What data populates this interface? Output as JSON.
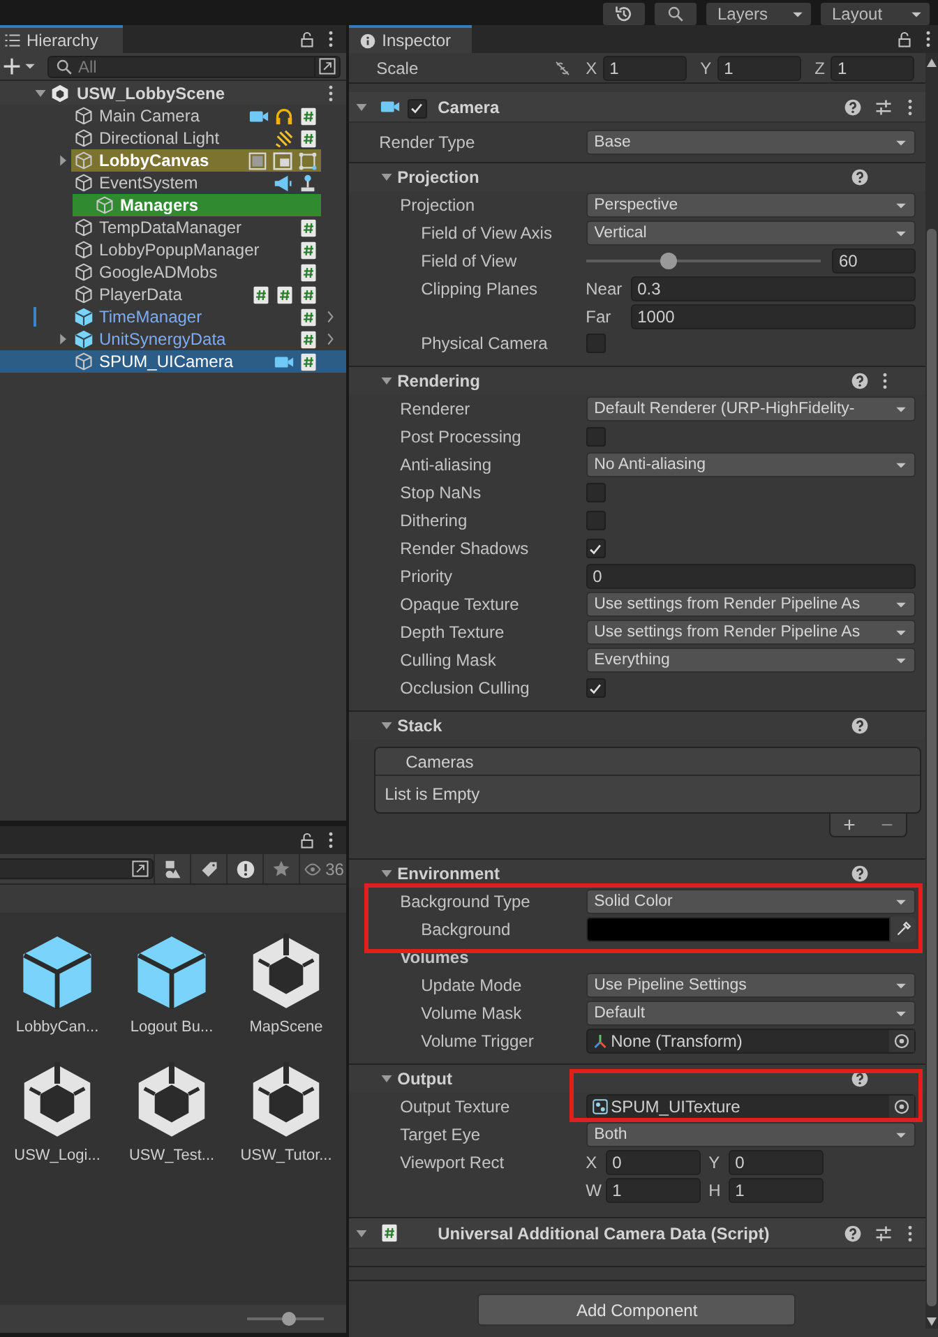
{
  "toolbar": {
    "buttons": [
      {
        "kind": "history"
      },
      {
        "kind": "search"
      }
    ],
    "dropdowns": [
      "Layers",
      "Layout"
    ]
  },
  "hierarchy": {
    "tab": "Hierarchy",
    "search": {
      "placeholder": "All"
    },
    "scene": {
      "name": "USW_LobbyScene",
      "expanded": true,
      "items": [
        {
          "name": "Main Camera",
          "kind": "object",
          "collapsed": false,
          "selected": false,
          "changed": false,
          "badges": [
            {
              "kind": "camera"
            },
            {
              "kind": "audio"
            },
            {
              "kind": "script"
            }
          ]
        },
        {
          "name": "Directional Light",
          "kind": "object",
          "collapsed": false,
          "selected": false,
          "changed": false,
          "badges": [
            {
              "kind": "light"
            },
            {
              "kind": "script"
            }
          ]
        },
        {
          "name": "LobbyCanvas",
          "kind": "object",
          "collapsed": true,
          "selected": false,
          "changed": false,
          "color": "#7d7331",
          "badges": [
            {
              "kind": "frame"
            },
            {
              "kind": "image"
            },
            {
              "kind": "rect"
            }
          ]
        },
        {
          "name": "EventSystem",
          "kind": "object",
          "collapsed": false,
          "selected": false,
          "changed": false,
          "badges": [
            {
              "kind": "megaphone"
            },
            {
              "kind": "joystick"
            }
          ],
          "children": [
            {
              "name": "Managers",
              "kind": "object",
              "collapsed": false,
              "selected": false,
              "changed": false,
              "color": "#2f8a30"
            }
          ]
        },
        {
          "name": "TempDataManager",
          "kind": "object",
          "collapsed": false,
          "selected": false,
          "changed": false,
          "badges": [
            {
              "kind": "script"
            }
          ]
        },
        {
          "name": "LobbyPopupManager",
          "kind": "object",
          "collapsed": false,
          "selected": false,
          "changed": false,
          "badges": [
            {
              "kind": "script"
            }
          ]
        },
        {
          "name": "GoogleADMobs",
          "kind": "object",
          "collapsed": false,
          "selected": false,
          "changed": false,
          "badges": [
            {
              "kind": "script"
            }
          ]
        },
        {
          "name": "PlayerData",
          "kind": "object",
          "collapsed": false,
          "selected": false,
          "changed": false,
          "badges": [
            {
              "kind": "script"
            },
            {
              "kind": "script"
            },
            {
              "kind": "script"
            }
          ]
        },
        {
          "name": "TimeManager",
          "kind": "prefab",
          "collapsed": false,
          "selected": false,
          "changed": true,
          "badges": [
            {
              "kind": "script"
            }
          ]
        },
        {
          "name": "UnitSynergyData",
          "kind": "prefab",
          "collapsed": true,
          "selected": false,
          "changed": false,
          "badges": [
            {
              "kind": "script"
            }
          ]
        },
        {
          "name": "SPUM_UICamera",
          "kind": "object",
          "collapsed": false,
          "selected": true,
          "changed": false,
          "badges": [
            {
              "kind": "camera"
            },
            {
              "kind": "script"
            }
          ]
        }
      ]
    }
  },
  "project": {
    "hidden_count": "36",
    "zoom": {
      "level": 0.55
    },
    "assets": [
      {
        "name": "LobbyCan...",
        "kind": "prefab"
      },
      {
        "name": "Logout Bu...",
        "kind": "prefab"
      },
      {
        "name": "MapScene",
        "kind": "scene"
      },
      {
        "name": "USW_Logi...",
        "kind": "scene"
      },
      {
        "name": "USW_Test...",
        "kind": "scene"
      },
      {
        "name": "USW_Tutor...",
        "kind": "scene"
      }
    ]
  },
  "inspector": {
    "tab": "Inspector",
    "scale": {
      "label": "Scale",
      "fields": [
        {
          "axis": "X",
          "value": "1"
        },
        {
          "axis": "Y",
          "value": "1"
        },
        {
          "axis": "Z",
          "value": "1"
        }
      ]
    },
    "components": [
      {
        "kind": "camera",
        "title": "Camera",
        "enabled": true,
        "expanded": true,
        "rows": [
          {
            "kind": "dropdown",
            "label": "Render Type",
            "value": "Base"
          }
        ],
        "sections": [
          {
            "title": "Projection",
            "expanded": true,
            "menu": false,
            "rows": [
              {
                "kind": "dropdown",
                "label": "Projection",
                "value": "Perspective",
                "children": [
                  {
                    "kind": "dropdown",
                    "label": "Field of View Axis",
                    "value": "Vertical"
                  },
                  {
                    "kind": "slider",
                    "label": "Field of View",
                    "level": 0.35,
                    "value": "60"
                  },
                  {
                    "kind": "pair",
                    "label": "Clipping Planes",
                    "fields": [
                      {
                        "prefix": "Near",
                        "value": "0.3"
                      },
                      {
                        "prefix": "Far",
                        "value": "1000"
                      }
                    ]
                  },
                  {
                    "kind": "checkbox",
                    "label": "Physical Camera",
                    "checked": false
                  }
                ]
              }
            ]
          },
          {
            "title": "Rendering",
            "expanded": true,
            "menu": true,
            "rows": [
              {
                "kind": "dropdown",
                "label": "Renderer",
                "value": "Default Renderer (URP-HighFidelity-"
              },
              {
                "kind": "checkbox",
                "label": "Post Processing",
                "checked": false
              },
              {
                "kind": "dropdown",
                "label": "Anti-aliasing",
                "value": "No Anti-aliasing"
              },
              {
                "kind": "checkbox",
                "label": "Stop NaNs",
                "checked": false
              },
              {
                "kind": "checkbox",
                "label": "Dithering",
                "checked": false
              },
              {
                "kind": "checkbox",
                "label": "Render Shadows",
                "checked": true
              },
              {
                "kind": "text",
                "label": "Priority",
                "value": "0"
              },
              {
                "kind": "dropdown",
                "label": "Opaque Texture",
                "value": "Use settings from Render Pipeline As"
              },
              {
                "kind": "dropdown",
                "label": "Depth Texture",
                "value": "Use settings from Render Pipeline As"
              },
              {
                "kind": "dropdown",
                "label": "Culling Mask",
                "value": "Everything"
              },
              {
                "kind": "checkbox",
                "label": "Occlusion Culling",
                "checked": true
              }
            ]
          },
          {
            "title": "Stack",
            "expanded": true,
            "menu": false,
            "rows": [
              {
                "kind": "list",
                "header": "Cameras",
                "empty_text": "List is Empty",
                "buttons": [
                  "+",
                  "−"
                ]
              }
            ]
          },
          {
            "title": "Environment",
            "expanded": true,
            "menu": false,
            "rows": [
              {
                "kind": "dropdown",
                "label": "Background Type",
                "value": "Solid Color",
                "callout": {
                  "kind": "group"
                },
                "children": [
                  {
                    "kind": "color",
                    "label": "Background",
                    "color": "#000000"
                  }
                ]
              },
              {
                "kind": "heading",
                "label": "Volumes",
                "children": [
                  {
                    "kind": "dropdown",
                    "label": "Update Mode",
                    "value": "Use Pipeline Settings"
                  },
                  {
                    "kind": "dropdown",
                    "label": "Volume Mask",
                    "value": "Default"
                  },
                  {
                    "kind": "object",
                    "label": "Volume Trigger",
                    "value": "None (Transform)",
                    "asset": {
                      "kind": "transform"
                    }
                  }
                ]
              }
            ]
          },
          {
            "title": "Output",
            "expanded": true,
            "menu": false,
            "rows": [
              {
                "kind": "object",
                "label": "Output Texture",
                "value": "SPUM_UITexture",
                "asset": {
                  "kind": "render_texture"
                },
                "callout": {
                  "kind": "field"
                }
              },
              {
                "kind": "dropdown",
                "label": "Target Eye",
                "value": "Both"
              },
              {
                "kind": "rect",
                "label": "Viewport Rect",
                "fields": [
                  {
                    "prefix": "X",
                    "value": "0"
                  },
                  {
                    "prefix": "Y",
                    "value": "0"
                  },
                  {
                    "prefix": "W",
                    "value": "1"
                  },
                  {
                    "prefix": "H",
                    "value": "1"
                  }
                ]
              }
            ]
          }
        ]
      },
      {
        "kind": "script",
        "title": "Universal Additional Camera Data (Script)",
        "expanded": true
      }
    ],
    "add_button": "Add Component"
  }
}
